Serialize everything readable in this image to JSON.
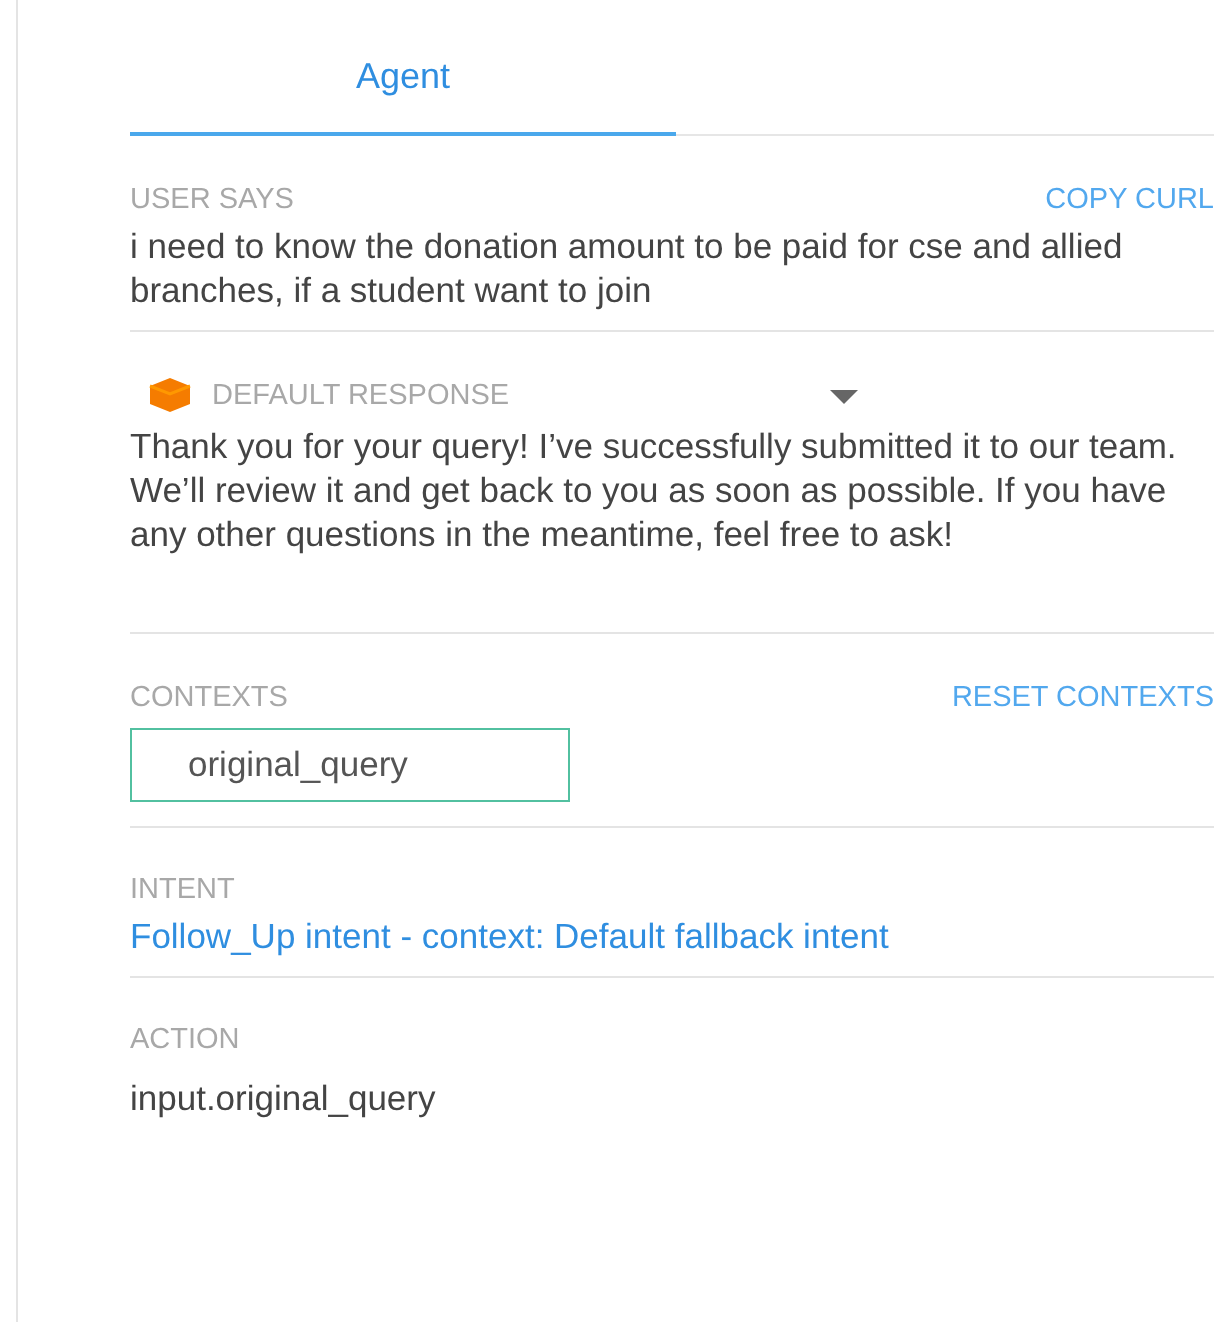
{
  "tabs": [
    {
      "label": "Agent",
      "selected": true
    }
  ],
  "user_says": {
    "label": "USER SAYS",
    "action": "COPY CURL",
    "text": "i need to know the donation amount to be paid for cse and allied branches, if a student want to join"
  },
  "response": {
    "label": "DEFAULT RESPONSE",
    "expanded": false,
    "text": "Thank you for your query! I’ve successfully submitted it to our team. We’ll review it and get back to you as soon as possible. If you have any other questions in the meantime, feel free to ask!"
  },
  "contexts": {
    "label": "CONTEXTS",
    "action": "RESET CONTEXTS",
    "items": [
      "original_query"
    ]
  },
  "intent": {
    "label": "INTENT",
    "link": "Follow_Up intent - context: Default fallback intent"
  },
  "action": {
    "label": "ACTION",
    "value": "input.original_query"
  }
}
